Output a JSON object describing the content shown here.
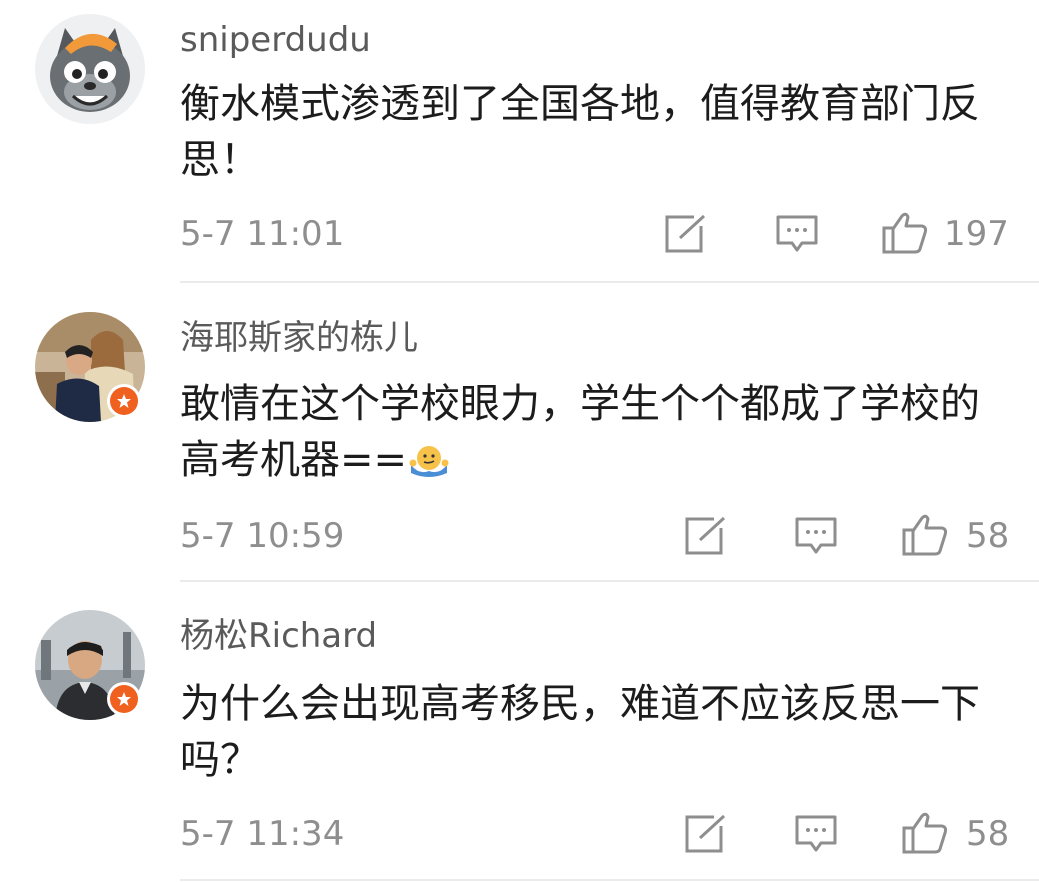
{
  "comments": [
    {
      "username": "sniperdudu",
      "text": "衡水模式渗透到了全国各地，值得教育部门反思！",
      "time": "5-7 11:01",
      "likes": "197",
      "verified": false,
      "avatar": "cartoon-wolf-avatar"
    },
    {
      "username": "海耶斯家的栋儿",
      "text": "敢情在这个学校眼力，学生个个都成了学校的高考机器==",
      "emoji": "shrug-emoji",
      "time": "5-7 10:59",
      "likes": "58",
      "verified": true,
      "avatar": "couple-photo-avatar"
    },
    {
      "username": "杨松Richard",
      "text": "为什么会出现高考移民，难道不应该反思一下吗？",
      "time": "5-7 11:34",
      "likes": "58",
      "verified": true,
      "avatar": "man-photo-avatar"
    }
  ],
  "icons": {
    "share": "share-icon",
    "comment": "comment-icon",
    "like": "like-icon",
    "verified": "verified-star-icon"
  },
  "colors": {
    "username": "#5a5a5a",
    "text": "#1c1c1c",
    "meta": "#8e8e8e",
    "divider": "#ebebeb",
    "verified_badge": "#f0601f"
  }
}
